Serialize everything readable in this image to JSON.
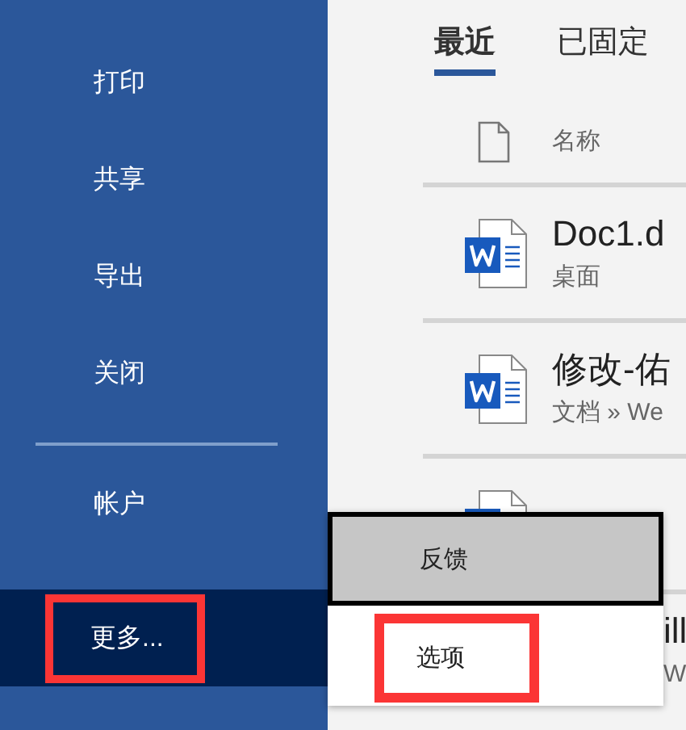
{
  "sidebar": {
    "items": [
      {
        "kind": "spacer"
      },
      {
        "label": "打印",
        "disabled": false,
        "selected": false,
        "marked": false
      },
      {
        "label": "共享",
        "disabled": false,
        "selected": false,
        "marked": false
      },
      {
        "label": "导出",
        "disabled": false,
        "selected": false,
        "marked": false
      },
      {
        "label": "关闭",
        "disabled": false,
        "selected": false,
        "marked": false
      },
      {
        "kind": "divider"
      },
      {
        "label": "帐户",
        "disabled": false,
        "selected": false,
        "marked": false
      },
      {
        "label": "更多...",
        "disabled": false,
        "selected": true,
        "marked": true
      }
    ]
  },
  "tabs": [
    {
      "label": "最近",
      "selected": true
    },
    {
      "label": "已固定",
      "selected": false
    }
  ],
  "file_list": {
    "header": "名称",
    "rows": [
      {
        "kind": "file",
        "title": "Doc1.d",
        "location": "桌面"
      },
      {
        "kind": "file",
        "title": "修改-佑",
        "location": "文档 » We"
      },
      {
        "kind": "file"
      },
      {
        "kind": "covered",
        "title": "ill",
        "location": "W"
      }
    ]
  },
  "popup_menu": {
    "items": [
      {
        "label": "反馈",
        "selected": true,
        "marked": false
      },
      {
        "label": "选项",
        "selected": false,
        "marked": true
      }
    ]
  }
}
